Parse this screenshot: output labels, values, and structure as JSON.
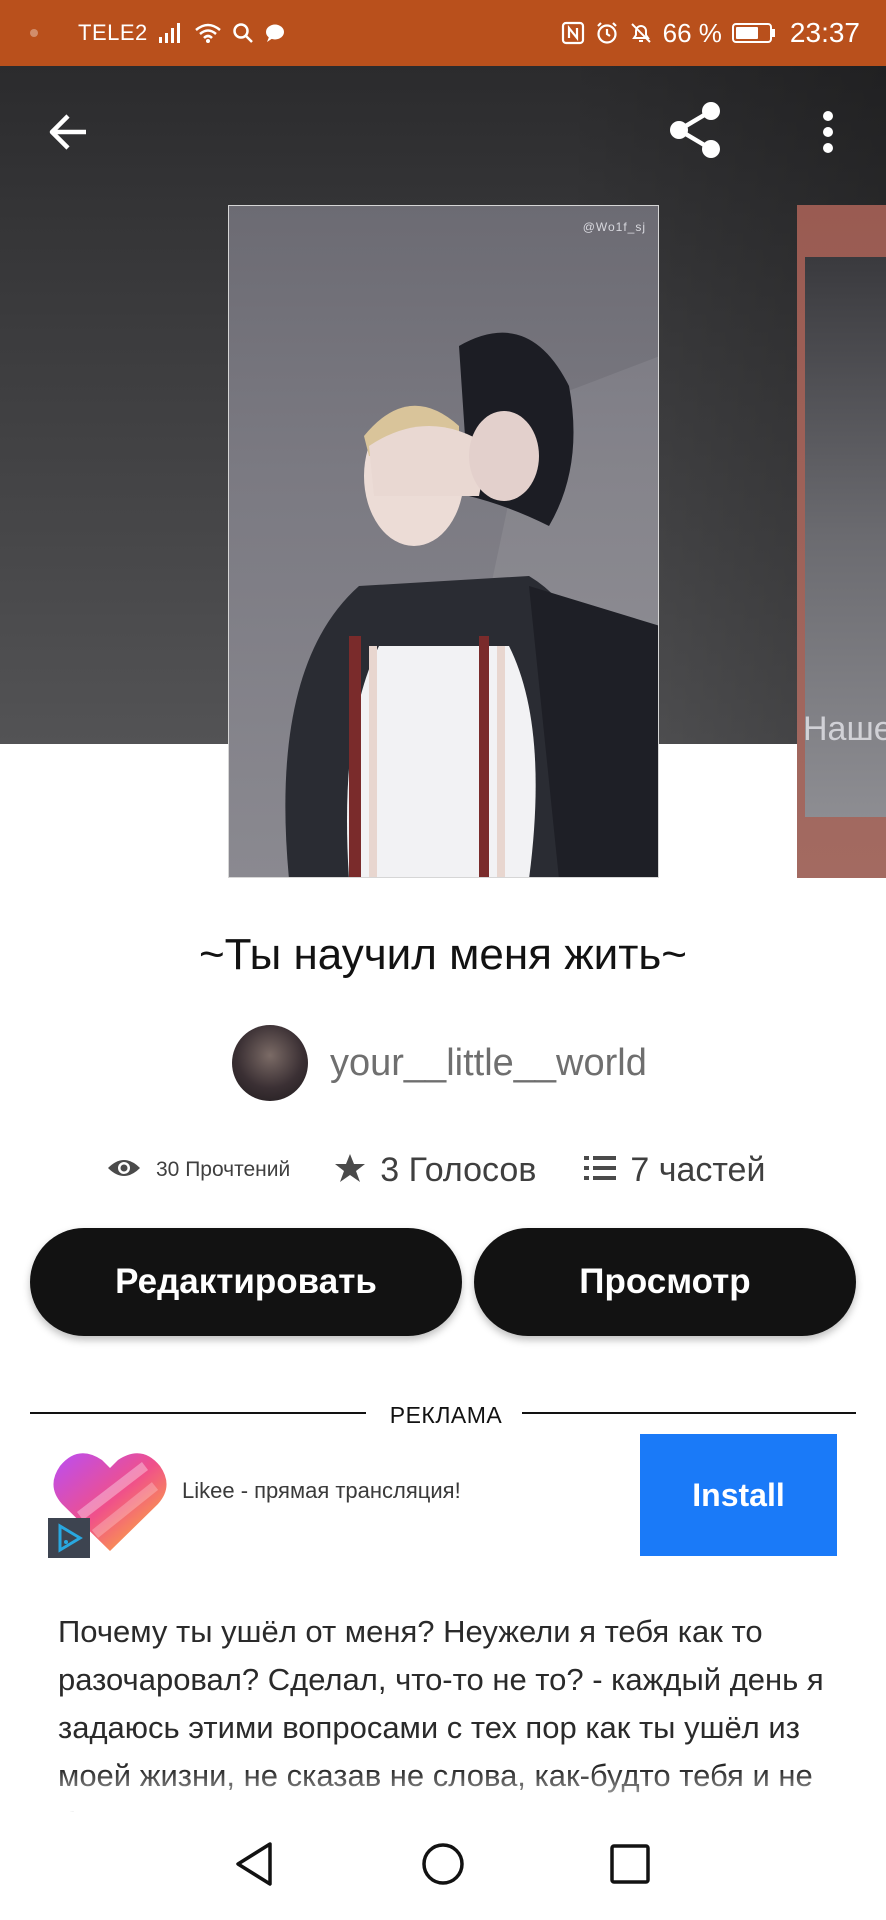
{
  "status_bar": {
    "carrier": "TELE2",
    "battery_percent": "66 %",
    "time": "23:37"
  },
  "header": {
    "back_icon": "arrow-left-icon",
    "share_icon": "share-icon",
    "more_icon": "more-vertical-icon"
  },
  "cover": {
    "watermark": "@Wo1f_sj",
    "next_cover_text": "Наше"
  },
  "story": {
    "title": "~Ты научил меня жить~",
    "author": "your__little__world",
    "reads": "30 Прочтений",
    "votes": "3 Голосов",
    "parts": "7 частей"
  },
  "actions": {
    "edit_label": "Редактировать",
    "preview_label": "Просмотр"
  },
  "ad": {
    "section_label": "РЕКЛАМА",
    "app_name": "Likee - прямая трансляция!",
    "install_label": "Install",
    "install_color": "#1a7af8"
  },
  "description": {
    "text": "Почему ты ушёл от меня? Неужели я тебя как то разочаровал? Сделал, что-то не то? - каждый день я задаюсь этими вопросами с тех пор как ты ушёл из моей жизни, не сказав не слова, как-будто тебя и не было..."
  },
  "colors": {
    "status_bar": "#b9501c",
    "button_bg": "#121212",
    "accent_install": "#1a7af8"
  }
}
